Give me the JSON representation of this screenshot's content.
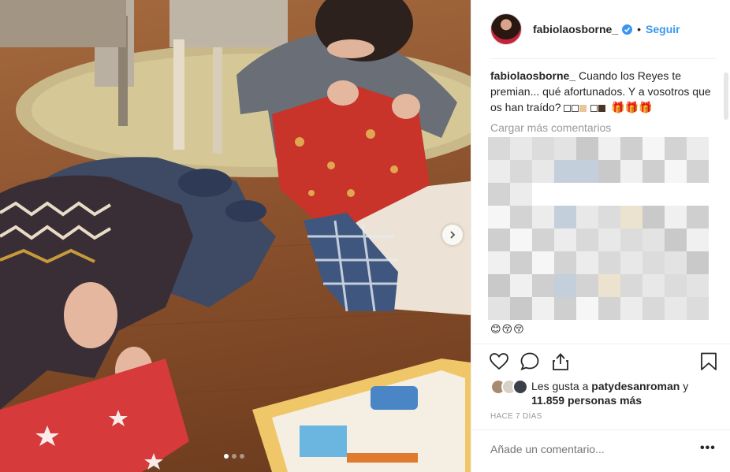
{
  "post": {
    "photo_alt": "",
    "carousel": {
      "count": 3,
      "active": 0
    }
  },
  "header": {
    "username": "fabiolaosborne_",
    "separator": "•",
    "follow_label": "Seguir"
  },
  "caption": {
    "username": "fabiolaosborne_",
    "text": "Cuando los Reyes te premian... qué afortunados. Y a vosotros que os han traído?",
    "trailing_gifts": "🎁🎁🎁"
  },
  "comments": {
    "load_more_label": "Cargar más comentarios",
    "reaction_emojis": "😊😚😚"
  },
  "likes": {
    "prefix": "Les gusta a",
    "top_liker": "patydesanroman",
    "connector": "y",
    "others": "11.859 personas más"
  },
  "timestamp": "HACE 7 DÍAS",
  "add_comment": {
    "placeholder": "Añade un comentario..."
  },
  "more_options": "•••",
  "colors": {
    "link_blue": "#3897f0",
    "muted_gray": "#999999",
    "text": "#262626",
    "divider": "#efefef"
  },
  "icons": {
    "like": "heart-outline-icon",
    "comment": "speech-bubble-icon",
    "share": "share-upload-icon",
    "save": "bookmark-icon",
    "verified": "verified-badge-icon",
    "next": "chevron-right-icon"
  }
}
